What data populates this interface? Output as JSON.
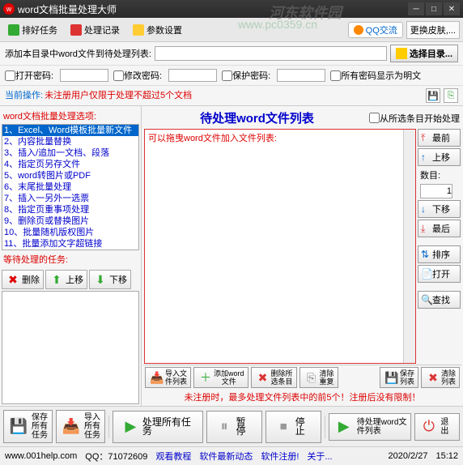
{
  "title": "word文档批量处理大师",
  "watermark": {
    "line1": "河东软件园",
    "line2": "www.pc0359.cn"
  },
  "topbar": {
    "btn1": "排好任务",
    "btn2": "处理记录",
    "btn3": "参数设置",
    "qq": "QQ交流",
    "skin": "更换皮肤,..."
  },
  "addrow": {
    "label": "添加本目录中word文件到待处理列表:",
    "select_btn": "选择目录..."
  },
  "pwrow": {
    "open": "打开密码:",
    "modify": "修改密码:",
    "protect": "保护密码:",
    "showplain": "所有密码显示为明文"
  },
  "status": {
    "label": "当前操作:",
    "value": "未注册用户仅限于处理不超过5个文档"
  },
  "left": {
    "title": "word文档批量处理选项:",
    "items": [
      "1、Excel、Word模板批量新文件",
      "2、内容批量替换",
      "3、插入/追加一文档、段落",
      "4、指定页另存文件",
      "5、word转图片或PDF",
      "6、末尾批量处理",
      "7、插入一另外一选票",
      "8、指定页重事项处理",
      "9、删除页或替换图片",
      "10、批量随机版权图片",
      "11、批量添加文字超链接"
    ],
    "wait_label": "等待处理的任务:",
    "btn_del": "删除",
    "btn_up": "上移",
    "btn_down": "下移"
  },
  "right": {
    "title": "待处理word文件列表",
    "check": "从所选条目开始处理",
    "hint": "可以拖曳word文件加入文件列表:",
    "side": {
      "top": "最前",
      "up": "上移",
      "num_label": "数目:",
      "num_value": "1",
      "down": "下移",
      "bottom": "最后",
      "sort": "排序",
      "open": "打开",
      "search": "查找"
    },
    "bottom": {
      "import": "导入文\n件列表",
      "add": "添加word\n文件",
      "remove": "删除所\n选条目",
      "clear_dup": "清除\n重复",
      "save": "保存\n列表",
      "clear": "清除\n列表"
    },
    "reg_warn": "未注册时，最多处理文件列表中的前5个！注册后没有限制！"
  },
  "bottom": {
    "save_all": "保存\n所有\n任务",
    "import_all": "导入\n所有\n任务",
    "process_all": "处理所有任务",
    "pause": "暂停",
    "stop": "停止",
    "pending": "待处理word文\n件列表",
    "exit": "退出"
  },
  "footer": {
    "site": "www.001help.com",
    "qq": "QQ：71072609",
    "link1": "观看教程",
    "link2": "软件最新动态",
    "link3": "软件注册!",
    "link4": "关于...",
    "date": "2020/2/27",
    "time": "15:12"
  }
}
